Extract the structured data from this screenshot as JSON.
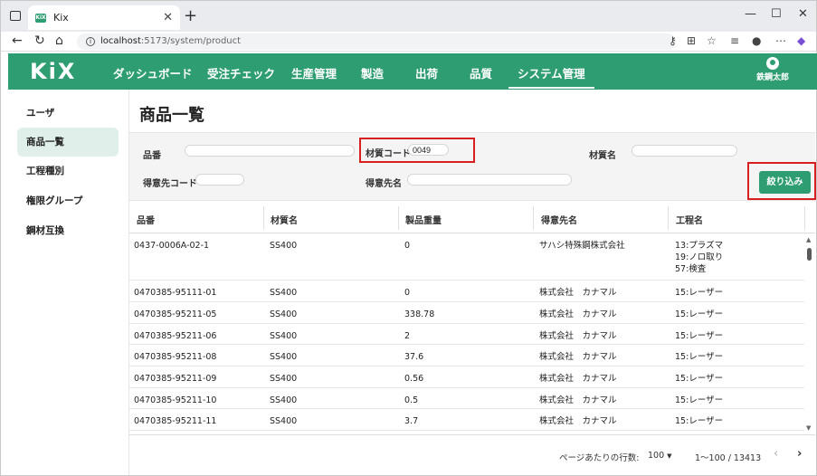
{
  "browser": {
    "tab_title": "Kix",
    "favicon_text": "KiX",
    "url_host": "localhost",
    "url_path": ":5173/system/product"
  },
  "header": {
    "logo": "KiX",
    "menu": [
      {
        "label": "ダッシュボード"
      },
      {
        "label": "受注チェック"
      },
      {
        "label": "生産管理"
      },
      {
        "label": "製造"
      },
      {
        "label": "出荷"
      },
      {
        "label": "品質"
      },
      {
        "label": "システム管理"
      }
    ],
    "user_name": "鉄鋼太郎"
  },
  "sidebar": {
    "items": [
      {
        "label": "ユーザ"
      },
      {
        "label": "商品一覧"
      },
      {
        "label": "工程種別"
      },
      {
        "label": "権限グループ"
      },
      {
        "label": "鋼材互換"
      }
    ]
  },
  "page": {
    "title": "商品一覧"
  },
  "filters": {
    "hinban_label": "品番",
    "hinban_value": "",
    "material_code_label": "材質コード",
    "material_code_value": "0049",
    "material_name_label": "材質名",
    "material_name_value": "",
    "customer_code_label": "得意先コード",
    "customer_code_value": "",
    "customer_name_label": "得意先名",
    "customer_name_value": "",
    "search_button": "絞り込み"
  },
  "table": {
    "columns": [
      "品番",
      "材質名",
      "製品重量",
      "得意先名",
      "工程名"
    ],
    "rows": [
      {
        "hinban": "0437-0006A-02-1",
        "material": "SS400",
        "weight": "0",
        "customer": "サハシ特殊鋼株式会社",
        "process": [
          "13:プラズマ",
          "19:ノロ取り",
          "57:検査"
        ]
      },
      {
        "hinban": "0470385-95111-01",
        "material": "SS400",
        "weight": "0",
        "customer": "株式会社　カナマル",
        "process": [
          "15:レーザー"
        ]
      },
      {
        "hinban": "0470385-95211-05",
        "material": "SS400",
        "weight": "338.78",
        "customer": "株式会社　カナマル",
        "process": [
          "15:レーザー"
        ]
      },
      {
        "hinban": "0470385-95211-06",
        "material": "SS400",
        "weight": "2",
        "customer": "株式会社　カナマル",
        "process": [
          "15:レーザー"
        ]
      },
      {
        "hinban": "0470385-95211-08",
        "material": "SS400",
        "weight": "37.6",
        "customer": "株式会社　カナマル",
        "process": [
          "15:レーザー"
        ]
      },
      {
        "hinban": "0470385-95211-09",
        "material": "SS400",
        "weight": "0.56",
        "customer": "株式会社　カナマル",
        "process": [
          "15:レーザー"
        ]
      },
      {
        "hinban": "0470385-95211-10",
        "material": "SS400",
        "weight": "0.5",
        "customer": "株式会社　カナマル",
        "process": [
          "15:レーザー"
        ]
      },
      {
        "hinban": "0470385-95211-11",
        "material": "SS400",
        "weight": "3.7",
        "customer": "株式会社　カナマル",
        "process": [
          "15:レーザー"
        ]
      },
      {
        "hinban": "",
        "material": "",
        "weight": "",
        "customer": "",
        "process": [
          ""
        ]
      }
    ]
  },
  "pagination": {
    "rows_per_page_label": "ページあたりの行数:",
    "rows_per_page_value": "100",
    "range": "1〜100 / 13413"
  },
  "colors": {
    "brand": "#2e9e72",
    "highlight": "#d81f1f"
  }
}
